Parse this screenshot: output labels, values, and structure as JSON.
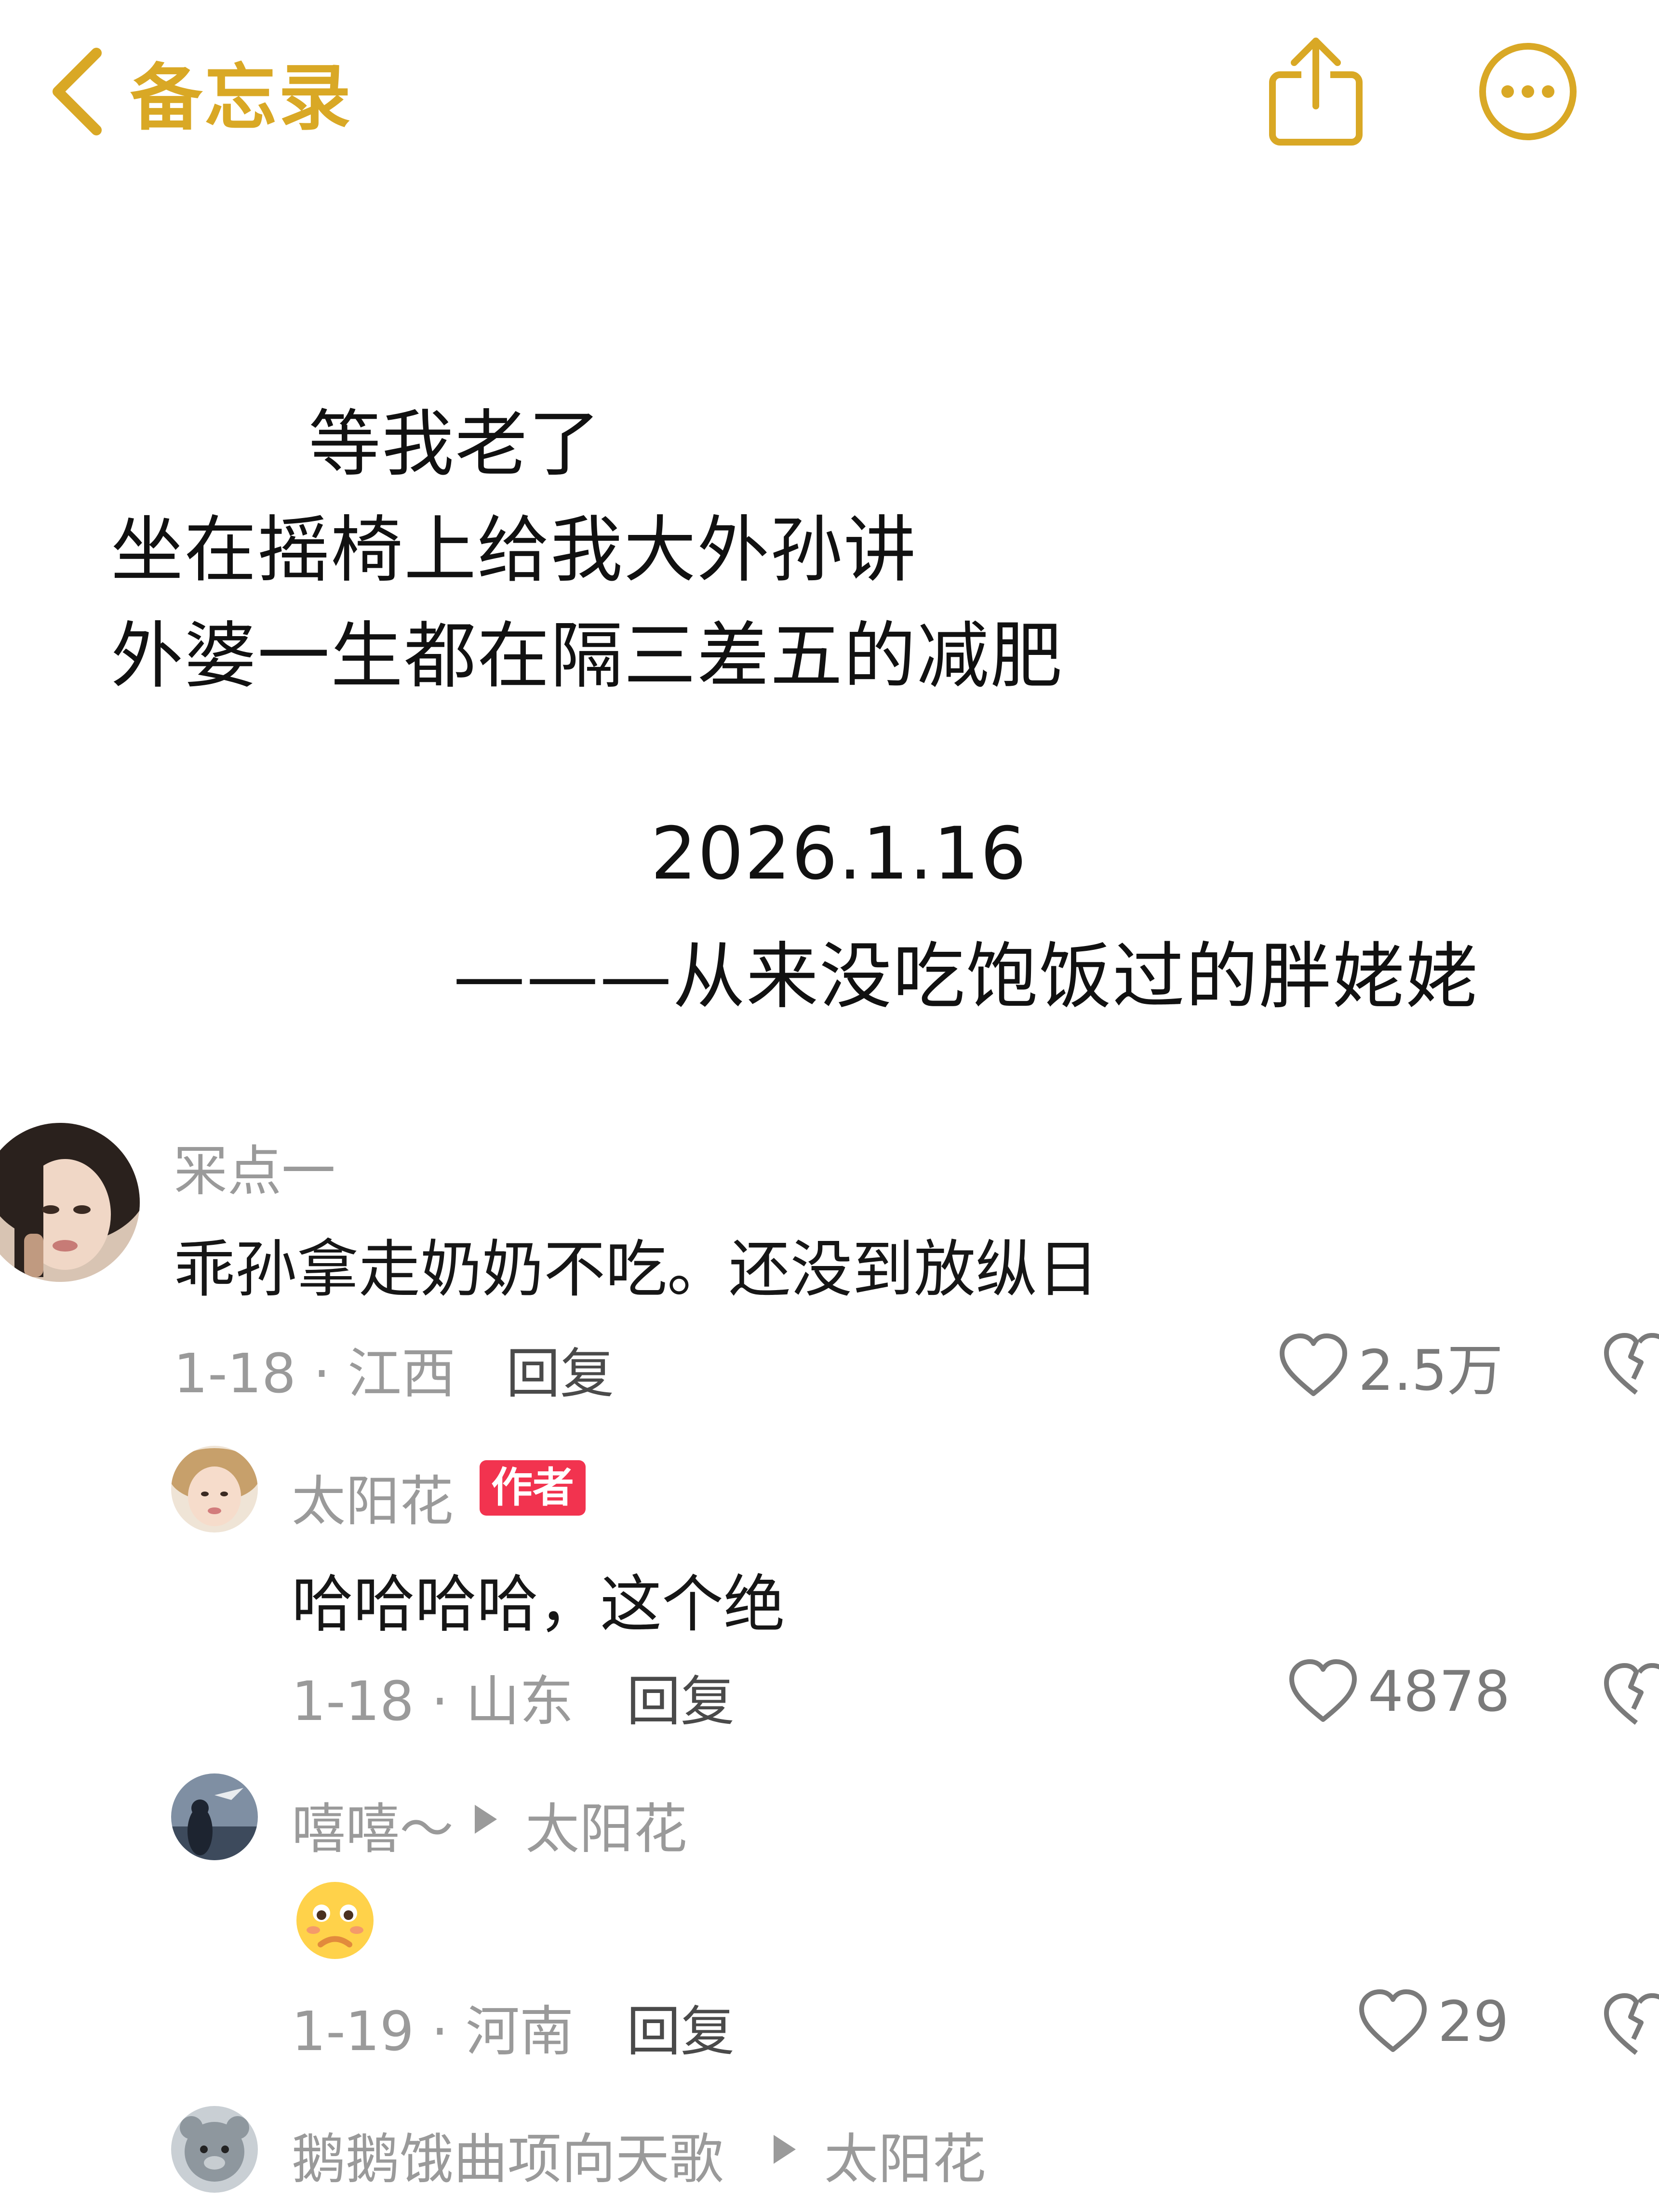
{
  "nav": {
    "back_label": "备忘录",
    "accent_color": "#d9a825",
    "share_icon": "share-icon",
    "more_icon": "more-icon"
  },
  "note": {
    "lines": [
      "等我老了",
      "坐在摇椅上给我大外孙讲",
      "外婆一生都在隔三差五的减肥",
      "2026.1.16",
      "———从来没吃饱饭过的胖姥姥"
    ]
  },
  "comments": [
    {
      "username": "冞点一",
      "text": "乖孙拿走奶奶不吃。还没到放纵日",
      "date_location": "1-18 · 江西",
      "reply_label": "回复",
      "likes": "2.5万"
    },
    {
      "username": "太阳花",
      "badge": "作者",
      "text": "哈哈哈哈，这个绝",
      "date_location": "1-18 · 山东",
      "reply_label": "回复",
      "likes": "4878"
    },
    {
      "username": "嘻嘻～",
      "reply_to": "太阳花",
      "text": "emoji-sticker",
      "date_location": "1-19 · 河南",
      "reply_label": "回复",
      "likes": "29"
    },
    {
      "username": "鹅鹅饿曲项向天歌",
      "reply_to": "太阳花"
    }
  ],
  "colors": {
    "badge": "#f2334f",
    "meta": "#9a9a9a"
  }
}
